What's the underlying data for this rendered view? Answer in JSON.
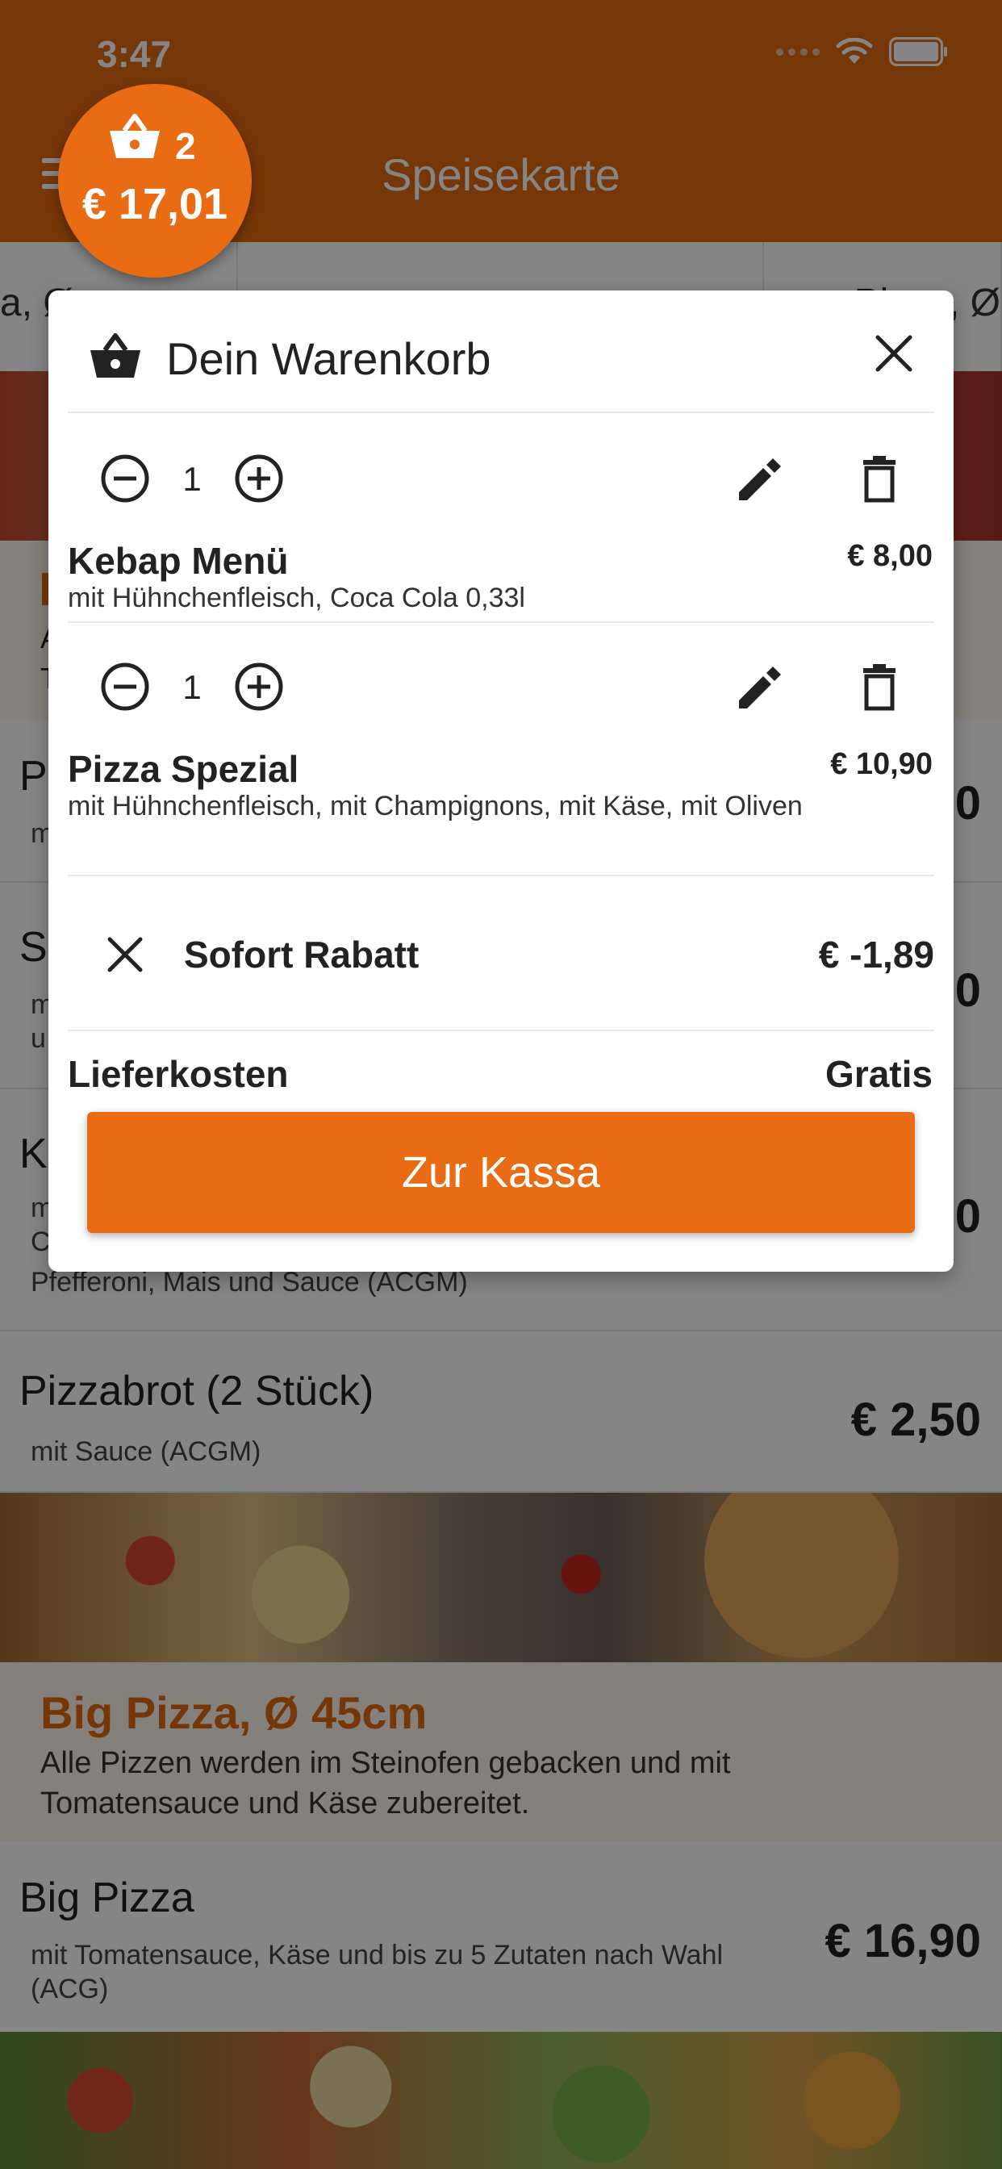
{
  "status_bar": {
    "time": "3:47"
  },
  "header": {
    "title": "Speisekarte"
  },
  "category_tabs": [
    "a, Ø",
    "",
    "Pizza, Ø"
  ],
  "menu": {
    "category_first": {
      "lines": [
        "A",
        "T"
      ]
    },
    "items": [
      {
        "name": "P",
        "desc": "m",
        "price": "0"
      },
      {
        "name": "S",
        "desc": "m u",
        "price": "0"
      },
      {
        "name": "K",
        "desc": "m C",
        "desc_tail": "Pfefferoni, Mais und Sauce (ACGM)",
        "price": "0"
      },
      {
        "name": "Pizzabrot (2 Stück)",
        "desc": "mit Sauce (ACGM)",
        "price": "€ 2,50"
      }
    ],
    "category_big_pizza": {
      "title": "Big Pizza, Ø 45cm",
      "description": "Alle Pizzen werden im Steinofen gebacken und mit Tomatensauce und Käse zubereitet."
    },
    "big_pizza_item": {
      "name": "Big Pizza",
      "desc": "mit Tomatensauce, Käse und bis zu 5 Zutaten nach Wahl (ACG)",
      "price": "€ 16,90"
    }
  },
  "cart_badge": {
    "count": "2",
    "total": "€ 17,01"
  },
  "cart": {
    "title": "Dein Warenkorb",
    "items": [
      {
        "quantity": "1",
        "name": "Kebap Menü",
        "options": "mit Hühnchenfleisch, Coca Cola 0,33l",
        "price": "€ 8,00"
      },
      {
        "quantity": "1",
        "name": "Pizza Spezial",
        "options": "mit Hühnchenfleisch, mit Champignons, mit Käse, mit Oliven",
        "price": "€ 10,90"
      }
    ],
    "discount": {
      "label": "Sofort Rabatt",
      "value": "€ -1,89"
    },
    "delivery": {
      "label": "Lieferkosten",
      "value": "Gratis"
    },
    "checkout_label": "Zur Kassa"
  },
  "colors": {
    "accent": "#E96C14",
    "overlay": "rgba(0,0,0,0.48)"
  },
  "icons": [
    "menu-icon",
    "wifi-icon",
    "battery-icon",
    "basket-icon",
    "close-icon",
    "minus-circle-icon",
    "plus-circle-icon",
    "edit-icon",
    "trash-icon"
  ]
}
